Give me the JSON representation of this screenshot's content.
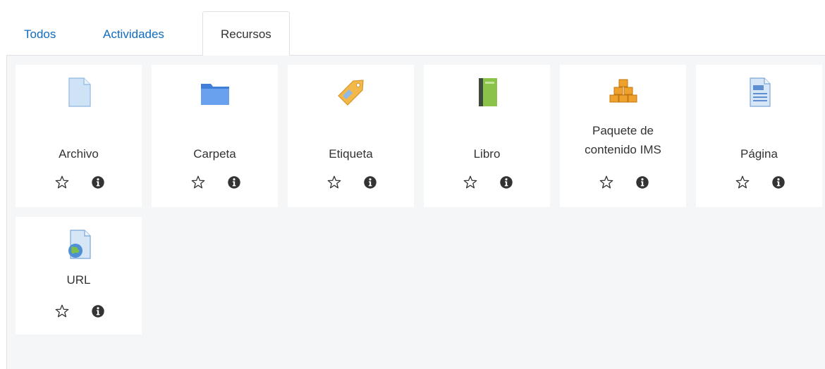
{
  "tabs": [
    {
      "label": "Todos",
      "active": false
    },
    {
      "label": "Actividades",
      "active": false
    },
    {
      "label": "Recursos",
      "active": true
    }
  ],
  "resources": [
    {
      "name": "Archivo",
      "icon": "file-icon"
    },
    {
      "name": "Carpeta",
      "icon": "folder-icon"
    },
    {
      "name": "Etiqueta",
      "icon": "label-tag-icon"
    },
    {
      "name": "Libro",
      "icon": "book-icon"
    },
    {
      "name_line1": "Paquete de",
      "name_line2": "contenido IMS",
      "icon": "ims-package-icon"
    },
    {
      "name": "Página",
      "icon": "page-icon"
    },
    {
      "name": "URL",
      "icon": "url-globe-icon"
    }
  ],
  "colors": {
    "link": "#0f6cbf",
    "panel_bg": "#f5f6f7",
    "text": "#333333"
  }
}
